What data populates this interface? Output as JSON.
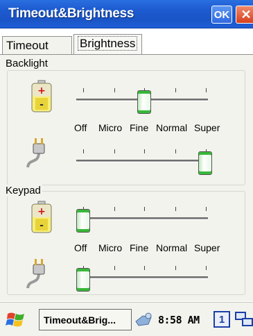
{
  "window": {
    "title": "Timeout&Brightness",
    "ok_label": "OK",
    "close_label": "✕"
  },
  "tabs": [
    {
      "label": "Timeout",
      "active": false
    },
    {
      "label": "Brightness",
      "active": true
    }
  ],
  "backlight": {
    "label": "Backlight",
    "scale_labels": [
      "Off",
      "Micro",
      "Fine",
      "Normal",
      "Super"
    ],
    "battery_level": "Fine",
    "ac_level": "Super"
  },
  "keypad": {
    "label": "Keypad",
    "scale_labels": [
      "Off",
      "Micro",
      "Fine",
      "Normal",
      "Super"
    ],
    "battery_level": "Off",
    "ac_level": "Off"
  },
  "icons": {
    "battery": "battery-icon",
    "power_plug": "power-plug-icon",
    "start": "windows-start-icon",
    "volume": "volume-icon",
    "network": "network-icon"
  },
  "taskbar": {
    "task_label": "Timeout&Brig...",
    "clock": "8:58 AM",
    "input_indicator": "1"
  },
  "colors": {
    "titlebar": "#1d5bd0",
    "thumb_accent": "#38b838",
    "close_button": "#d6401e"
  }
}
